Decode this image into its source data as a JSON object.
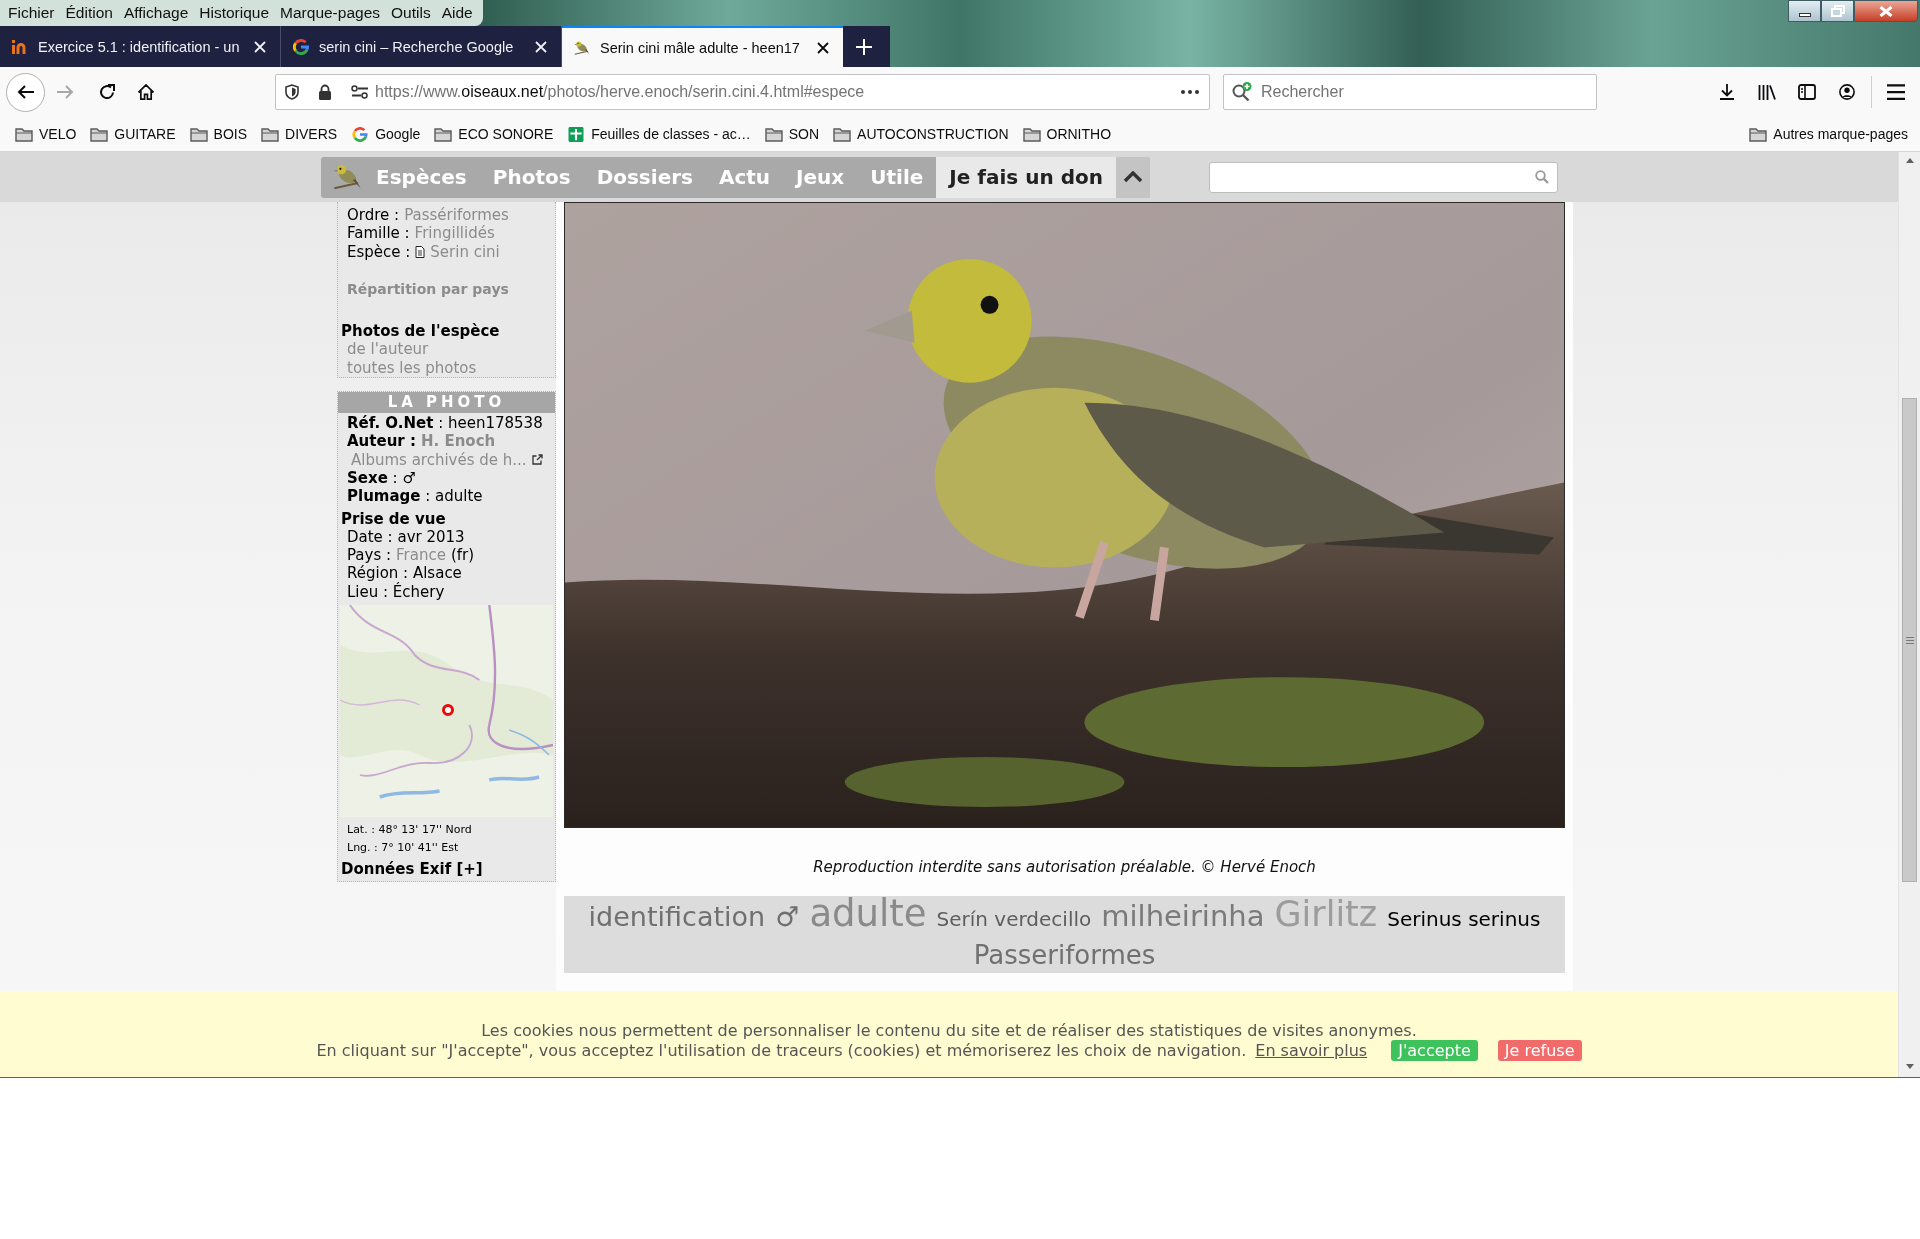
{
  "menu_bar": [
    "Fichier",
    "Édition",
    "Affichage",
    "Historique",
    "Marque-pages",
    "Outils",
    "Aide"
  ],
  "tabs": [
    {
      "title": "Exercice 5.1 : identification - un",
      "kind": "in_logo",
      "selected": false
    },
    {
      "title": "serin cini – Recherche Google",
      "kind": "g_logo",
      "selected": false
    },
    {
      "title": "Serin cini mâle adulte - heen17",
      "kind": "bird",
      "selected": true
    }
  ],
  "address_bar": {
    "url_start": "https://www.",
    "url_domain": "oiseaux.net",
    "url_rest": "/photos/herve.enoch/serin.cini.4.html#espece"
  },
  "search_bar": {
    "placeholder": "Rechercher"
  },
  "bookmarks": [
    {
      "label": "VELO",
      "kind": "folder"
    },
    {
      "label": "GUITARE",
      "kind": "folder"
    },
    {
      "label": "BOIS",
      "kind": "folder"
    },
    {
      "label": "DIVERS",
      "kind": "folder"
    },
    {
      "label": "Google",
      "kind": "g_logo"
    },
    {
      "label": "ECO SONORE",
      "kind": "folder"
    },
    {
      "label": "Feuilles de classes - ac…",
      "kind": "sheet"
    },
    {
      "label": "SON",
      "kind": "folder"
    },
    {
      "label": "AUTOCONSTRUCTION",
      "kind": "folder"
    },
    {
      "label": "ORNITHO",
      "kind": "folder"
    }
  ],
  "other_bookmarks": {
    "label": "Autres marque-pages",
    "kind": "folder"
  },
  "site_nav": [
    {
      "label": "Espèces",
      "kind": "menu"
    },
    {
      "label": "Photos",
      "kind": "menu"
    },
    {
      "label": "Dossiers",
      "kind": "menu"
    },
    {
      "label": "Actu",
      "kind": "menu"
    },
    {
      "label": "Jeux",
      "kind": "menu"
    },
    {
      "label": "Utile",
      "kind": "menu"
    },
    {
      "label": "Je fais un don",
      "kind": "donate"
    }
  ],
  "classification_card": {
    "rows": [
      {
        "kind": "link",
        "label": "Ordre :",
        "link": "Passériformes"
      },
      {
        "kind": "link",
        "label": "Famille :",
        "link": "Fringillidés"
      },
      {
        "kind": "doc_link",
        "label": "Espèce :",
        "link": "Serin cini"
      },
      {
        "kind": "section_link",
        "link": "Répartition par pays"
      },
      {
        "kind": "heading",
        "text": "Photos de l'espèce"
      },
      {
        "kind": "sublink",
        "link": "de l'auteur"
      },
      {
        "kind": "sublink",
        "link": "toutes les photos"
      }
    ]
  },
  "photo_card": {
    "title": "LA PHOTO",
    "rows": [
      {
        "kind": "rich",
        "text": "**Réf. O.Net** : heen178538"
      },
      {
        "kind": "bold_link",
        "label": "Auteur :",
        "link": "H. Enoch"
      },
      {
        "kind": "external_link",
        "link": "Albums archivés de h..."
      },
      {
        "kind": "rich",
        "text": "**Sexe** : ♂"
      },
      {
        "kind": "rich",
        "text": "**Plumage** : adulte"
      },
      {
        "kind": "heading",
        "text": "Prise de vue"
      },
      {
        "kind": "text",
        "text": "Date : avr 2013"
      },
      {
        "kind": "link",
        "label": "Pays :",
        "link": "France",
        "suffix": "(fr)"
      },
      {
        "kind": "text",
        "text": "Région : Alsace"
      },
      {
        "kind": "text",
        "text": "Lieu : Échery"
      }
    ],
    "coordinates": [
      "Lat. : 48° 13' 17'' Nord",
      "Lng. : 7° 10' 41'' Est"
    ],
    "exif_toggle": "Données Exif [+]"
  },
  "photo": {
    "caption": "Reproduction interdite sans autorisation préalable. © Hervé Enoch"
  },
  "tags": [
    {
      "label": "identification",
      "kind": "medium",
      "color": "#707070"
    },
    {
      "label": "♂",
      "kind": "medium",
      "color": "#707070"
    },
    {
      "label": "adulte",
      "kind": "huge",
      "color": "#8a8a8a"
    },
    {
      "label": "Serín verdecillo",
      "kind": "small",
      "color": "#5e5e5e"
    },
    {
      "label": "milheirinha",
      "kind": "large",
      "color": "#7a7a7a"
    },
    {
      "label": "Girlitz",
      "kind": "big",
      "color": "#9c9c9c"
    },
    {
      "label": "Serinus serinus",
      "kind": "small",
      "color": "#000000"
    },
    {
      "label": "Passeriformes",
      "kind": "normal",
      "color": "#707070"
    }
  ],
  "cookie_banner": {
    "line_1": "Les cookies nous permettent de personnaliser le contenu du site et de réaliser des statistiques de visites anonymes.",
    "line_2": "En cliquant sur \"J'accepte\", vous acceptez l'utilisation de traceurs (cookies) et mémoriserez les choix de navigation.",
    "link": "En savoir plus",
    "buttons": [
      {
        "label": "J'accepte",
        "kind": "accept"
      },
      {
        "label": "Je refuse",
        "kind": "refuse"
      }
    ]
  }
}
